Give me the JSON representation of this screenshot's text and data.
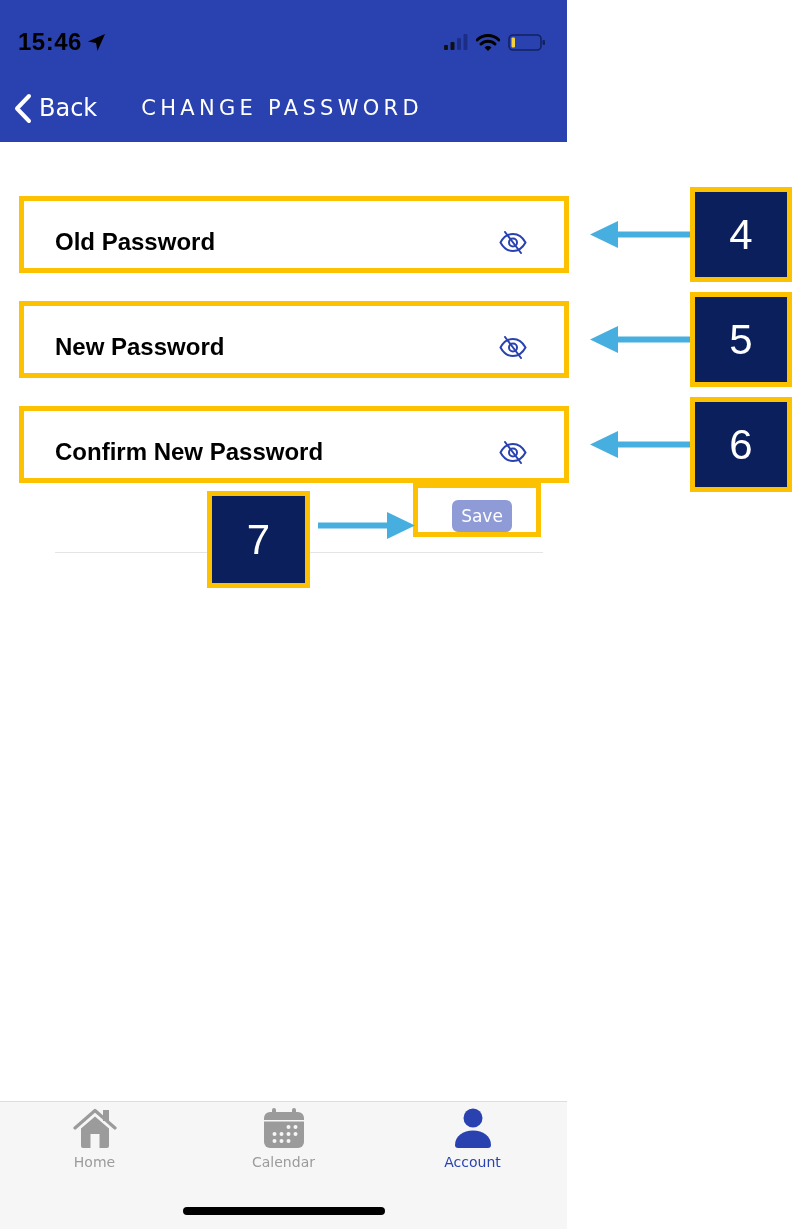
{
  "status_bar": {
    "time": "15:46"
  },
  "nav_bar": {
    "back_label": "Back",
    "title": "CHANGE PASSWORD"
  },
  "form": {
    "fields": [
      {
        "placeholder": "Old Password",
        "visible": false,
        "callout": "4"
      },
      {
        "placeholder": "New Password",
        "visible": false,
        "callout": "5"
      },
      {
        "placeholder": "Confirm New Password",
        "visible": false,
        "callout": "6"
      }
    ],
    "save_button": {
      "label": "Save",
      "disabled": true,
      "callout": "7"
    }
  },
  "tab_bar": [
    {
      "label": "Home",
      "selected": false
    },
    {
      "label": "Calendar",
      "selected": false
    },
    {
      "label": "Account",
      "selected": true
    }
  ]
}
